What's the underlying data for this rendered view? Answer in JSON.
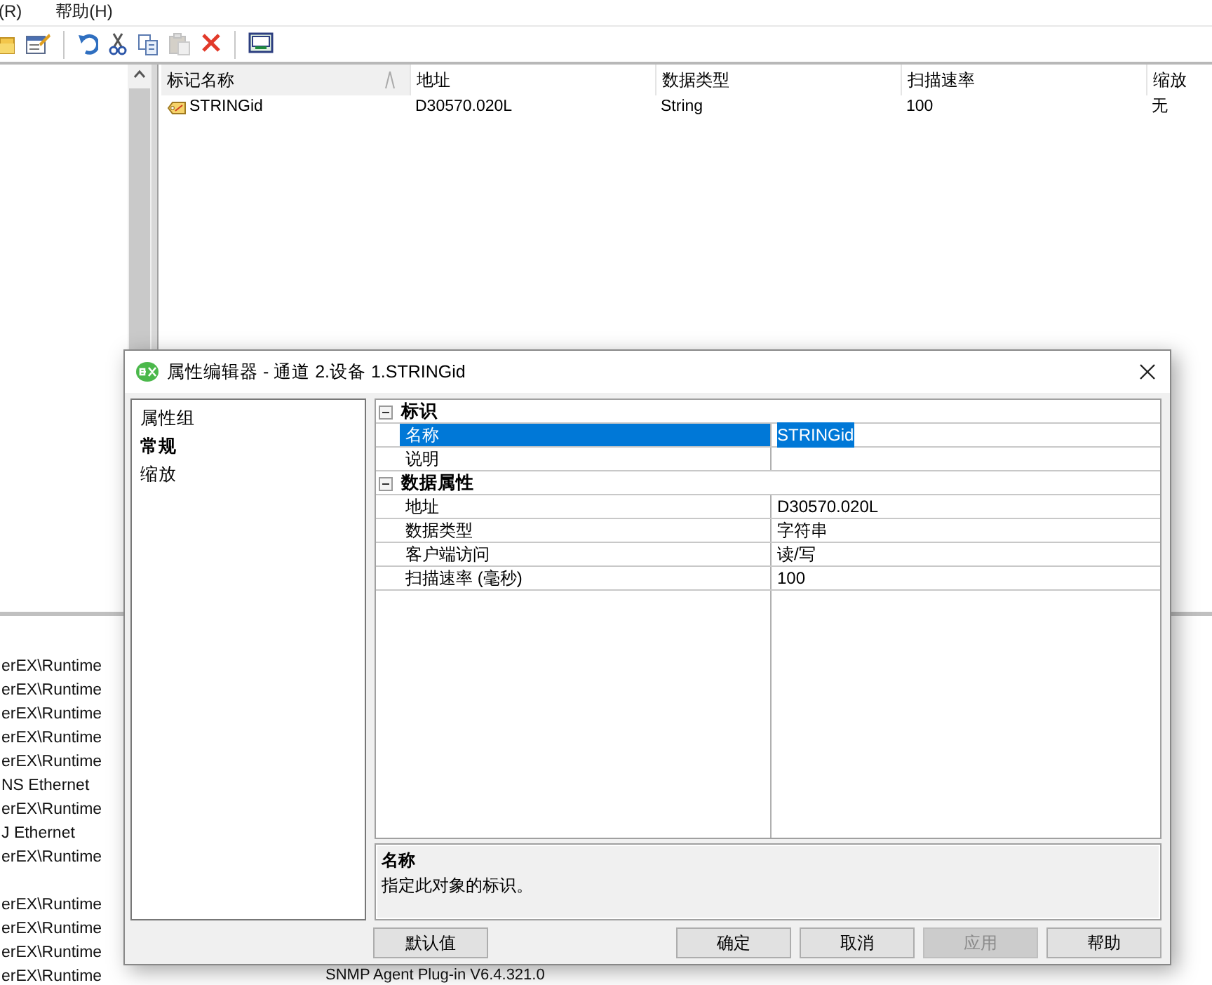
{
  "menu": [
    {
      "label": "(R)"
    },
    {
      "label": "帮助(H)"
    }
  ],
  "toolbar": [
    {
      "kind": "folder",
      "disabled": false
    },
    {
      "kind": "properties",
      "disabled": false
    },
    {
      "kind": "sep"
    },
    {
      "kind": "undo",
      "disabled": false
    },
    {
      "kind": "cut",
      "disabled": false
    },
    {
      "kind": "copy",
      "disabled": false
    },
    {
      "kind": "paste",
      "disabled": true
    },
    {
      "kind": "delete",
      "disabled": false
    },
    {
      "kind": "sep"
    },
    {
      "kind": "qc",
      "disabled": false
    }
  ],
  "tag_table": {
    "columns": [
      {
        "label": "标记名称",
        "sorted": true
      },
      {
        "label": "地址",
        "sorted": false
      },
      {
        "label": "数据类型",
        "sorted": false
      },
      {
        "label": "扫描速率",
        "sorted": false
      },
      {
        "label": "缩放",
        "sorted": false
      }
    ],
    "rows": [
      {
        "cells": [
          "STRINGid",
          "D30570.020L",
          "String",
          "100",
          "无"
        ]
      }
    ]
  },
  "log_lines": [
    {
      "kind": "line",
      "text": "erEX\\Runtime"
    },
    {
      "kind": "line",
      "text": "erEX\\Runtime"
    },
    {
      "kind": "line",
      "text": "erEX\\Runtime"
    },
    {
      "kind": "line",
      "text": "erEX\\Runtime"
    },
    {
      "kind": "line",
      "text": "erEX\\Runtime"
    },
    {
      "kind": "line",
      "text": "NS Ethernet"
    },
    {
      "kind": "line",
      "text": "erEX\\Runtime"
    },
    {
      "kind": "line",
      "text": "J Ethernet"
    },
    {
      "kind": "line",
      "text": "erEX\\Runtime"
    },
    {
      "kind": "blank"
    },
    {
      "kind": "line",
      "text": "erEX\\Runtime"
    },
    {
      "kind": "line",
      "text": "erEX\\Runtime"
    },
    {
      "kind": "line",
      "text": "erEX\\Runtime"
    },
    {
      "kind": "line",
      "text": "erEX\\Runtime"
    }
  ],
  "status_text": "SNMP Agent Plug-in V6.4.321.0",
  "dialog": {
    "title": "属性编辑器 - 通道 2.设备 1.STRINGid",
    "groups_label": "属性组",
    "groups": [
      {
        "label": "常规",
        "selected": true
      },
      {
        "label": "缩放",
        "selected": false
      }
    ],
    "sections": [
      {
        "title": "标识",
        "expanded": true,
        "rows": [
          {
            "name": "名称",
            "value": "STRINGid",
            "selected": true
          },
          {
            "name": "说明",
            "selected": false
          }
        ]
      },
      {
        "title": "数据属性",
        "expanded": true,
        "rows": [
          {
            "name": "地址",
            "value": "D30570.020L",
            "selected": false
          },
          {
            "name": "数据类型",
            "value": "字符串",
            "selected": false
          },
          {
            "name": "客户端访问",
            "value": "读/写",
            "selected": false
          },
          {
            "name": "扫描速率 (毫秒)",
            "value": "100",
            "selected": false
          }
        ]
      }
    ],
    "description": {
      "title": "名称",
      "text": "指定此对象的标识。"
    },
    "buttons": [
      {
        "label": "默认值",
        "disabled": false
      },
      {
        "label": "确定",
        "disabled": false
      },
      {
        "label": "取消",
        "disabled": false
      },
      {
        "label": "应用",
        "disabled": true
      },
      {
        "label": "帮助",
        "disabled": false
      }
    ]
  }
}
